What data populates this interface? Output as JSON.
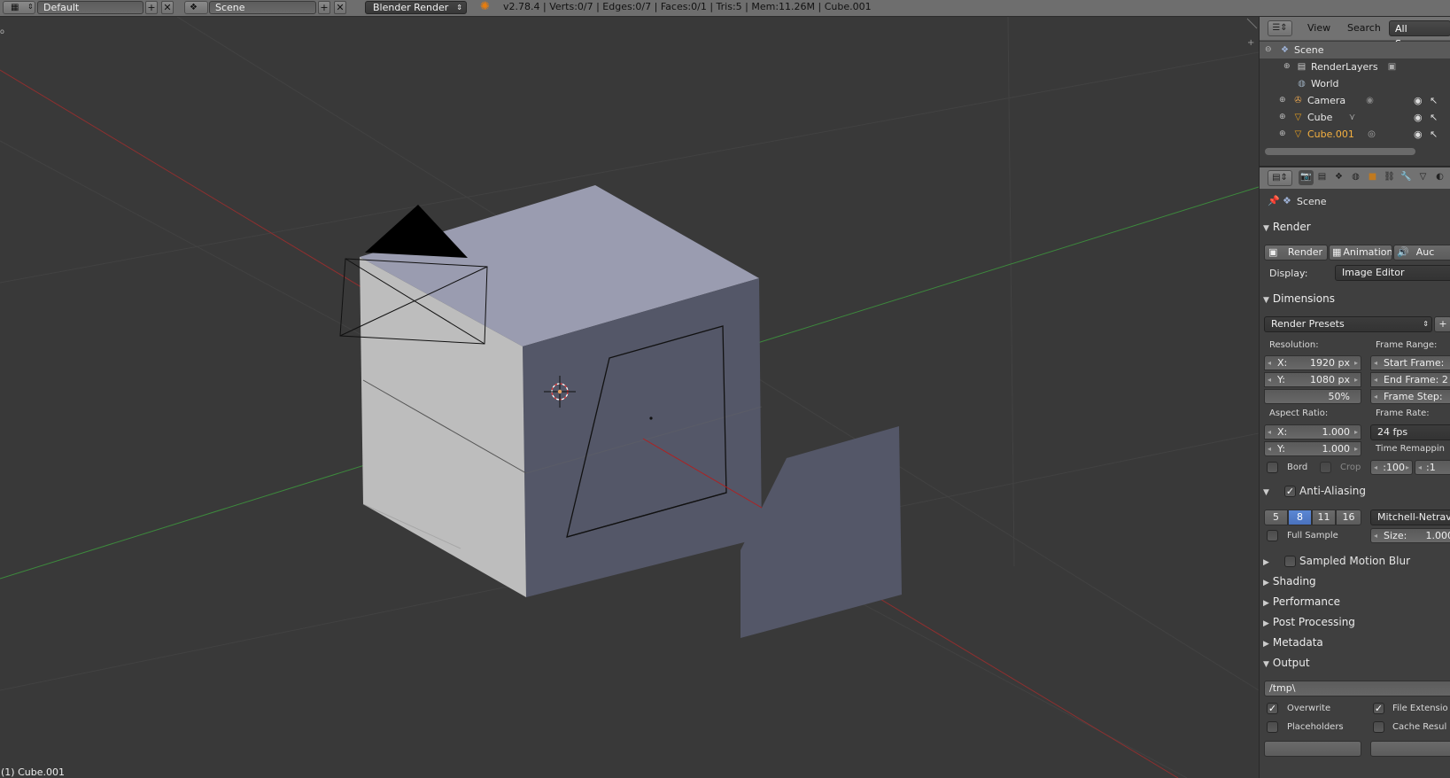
{
  "header": {
    "layout_name": "Default",
    "scene_name": "Scene",
    "render_engine": "Blender Render",
    "info_stats": "v2.78.4 | Verts:0/7 | Edges:0/7 | Faces:0/1 | Tris:5 | Mem:11.26M | Cube.001"
  },
  "viewport": {
    "object_label": "(1) Cube.001",
    "corner_label": "o"
  },
  "outliner": {
    "menu": {
      "view": "View",
      "search": "Search",
      "display_mode": "All Scenes"
    },
    "rows": [
      {
        "label": "Scene"
      },
      {
        "label": "RenderLayers"
      },
      {
        "label": "World"
      },
      {
        "label": "Camera"
      },
      {
        "label": "Cube"
      },
      {
        "label": "Cube.001"
      }
    ]
  },
  "properties": {
    "context_label": "Scene",
    "render_panel": {
      "title": "Render",
      "render_button": "Render",
      "animation_button": "Animation",
      "audio_button": "Auc",
      "display_label": "Display:",
      "display_value": "Image Editor"
    },
    "dimensions_panel": {
      "title": "Dimensions",
      "presets": "Render Presets",
      "resolution_label": "Resolution:",
      "res_x_label": "X:",
      "res_x": "1920 px",
      "res_y_label": "Y:",
      "res_y": "1080 px",
      "res_pct": "50%",
      "aspect_label": "Aspect Ratio:",
      "aspect_x_label": "X:",
      "aspect_x": "1.000",
      "aspect_y_label": "Y:",
      "aspect_y": "1.000",
      "border_label": "Bord",
      "crop_label": "Crop",
      "frame_range_label": "Frame Range:",
      "start_frame": "Start Frame:",
      "end_frame": "End Frame: 2",
      "frame_step": "Frame Step:",
      "frame_rate_label": "Frame Rate:",
      "fps": "24 fps",
      "time_remap_label": "Time Remappin",
      "remap_old": ":100",
      "remap_new": ":1"
    },
    "aa_panel": {
      "title": "Anti-Aliasing",
      "samples": [
        "5",
        "8",
        "11",
        "16"
      ],
      "active_sample": "8",
      "filter": "Mitchell-Netrav",
      "full_sample_label": "Full Sample",
      "size_label": "Size:",
      "size_value": "1.000"
    },
    "collapsed_panels": {
      "motion_blur": "Sampled Motion Blur",
      "shading": "Shading",
      "performance": "Performance",
      "post_processing": "Post Processing",
      "metadata": "Metadata"
    },
    "output_panel": {
      "title": "Output",
      "path": "/tmp\\",
      "overwrite": "Overwrite",
      "file_extensions": "File Extensio",
      "placeholders": "Placeholders",
      "cache_result": "Cache Resul"
    }
  },
  "colors": {
    "header_bg": "#6e6e6e",
    "viewport_bg": "#393939",
    "x_axis": "#9b2f2f",
    "y_axis": "#3f8f3f",
    "cube_top": "#9a9cb0",
    "cube_right": "#555868",
    "cube_left": "#bcbcbc",
    "selected_accent": "#5b87d4"
  }
}
